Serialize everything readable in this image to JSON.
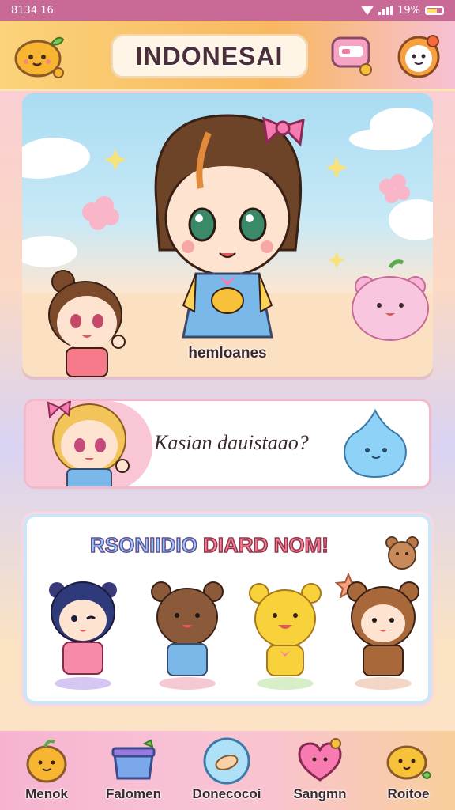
{
  "status": {
    "time": "8134 16",
    "battery": "19%"
  },
  "header": {
    "title": "INDONESAI"
  },
  "hero": {
    "character_name": "hemloanes"
  },
  "dialog": {
    "text": "Kasian dauistaao?"
  },
  "select": {
    "banner_part1": "RSONIIDIO",
    "banner_part2": "DIARD NOM!"
  },
  "nav": {
    "items": [
      {
        "label": "Menok",
        "icon": "potato-icon"
      },
      {
        "label": "Falomen",
        "icon": "box-icon"
      },
      {
        "label": "Donecocoi",
        "icon": "bubble-icon"
      },
      {
        "label": "Sangmn",
        "icon": "heart-icon"
      },
      {
        "label": "Roitoe",
        "icon": "potato-plant-icon"
      }
    ]
  },
  "colors": {
    "accent_pink": "#f6b3cf",
    "accent_orange": "#f9b85f",
    "text_dark": "#3a2a30"
  }
}
